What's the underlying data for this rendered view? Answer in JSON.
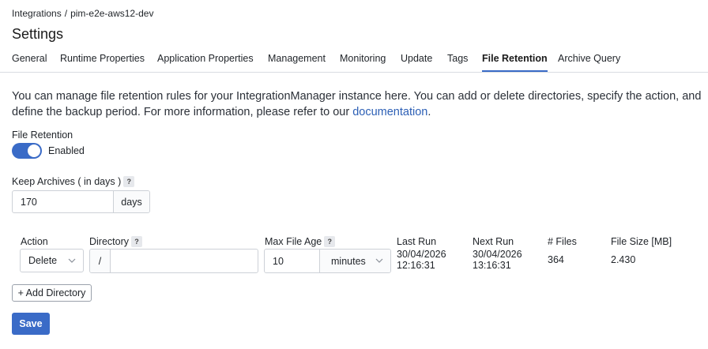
{
  "breadcrumb": {
    "root": "Integrations",
    "separator": "/",
    "current": "pim-e2e-aws12-dev"
  },
  "page_title": "Settings",
  "tabs": [
    {
      "label": "General"
    },
    {
      "label": "Runtime Properties"
    },
    {
      "label": "Application Properties"
    },
    {
      "label": "Management"
    },
    {
      "label": "Monitoring"
    },
    {
      "label": "Update"
    },
    {
      "label": "Tags"
    },
    {
      "label": "File Retention",
      "active": true
    },
    {
      "label": "Archive Query"
    }
  ],
  "description": {
    "text": "You can manage file retention rules for your IntegrationManager instance here. You can add or delete directories, specify the action, and define the backup period. For more information, please refer to our ",
    "link_text": "documentation",
    "suffix": "."
  },
  "file_retention": {
    "label": "File Retention",
    "toggle_state": "Enabled",
    "enabled": true
  },
  "keep_archives": {
    "label": "Keep Archives ( in days )",
    "help": "?",
    "value": "170",
    "unit": "days"
  },
  "table": {
    "headers": {
      "action": "Action",
      "directory": "Directory",
      "directory_help": "?",
      "max_file_age": "Max File Age",
      "max_file_age_help": "?",
      "last_run": "Last Run",
      "next_run": "Next Run",
      "files": "# Files",
      "file_size": "File Size [MB]"
    },
    "rows": [
      {
        "action": "Delete",
        "dir_prefix": "/",
        "directory": "",
        "max_age_value": "10",
        "max_age_unit": "minutes",
        "last_run_date": "30/04/2026",
        "last_run_time": "12:16:31",
        "next_run_date": "30/04/2026",
        "next_run_time": "13:16:31",
        "files": "364",
        "file_size": "2.430"
      }
    ]
  },
  "add_directory_label": "+ Add Directory",
  "save_label": "Save",
  "colors": {
    "accent": "#3a6bc7",
    "link": "#2c5fb5",
    "border": "#cdd1d7"
  },
  "icons": {
    "help": "question-mark-icon",
    "dropdown": "chevron-down-icon"
  }
}
